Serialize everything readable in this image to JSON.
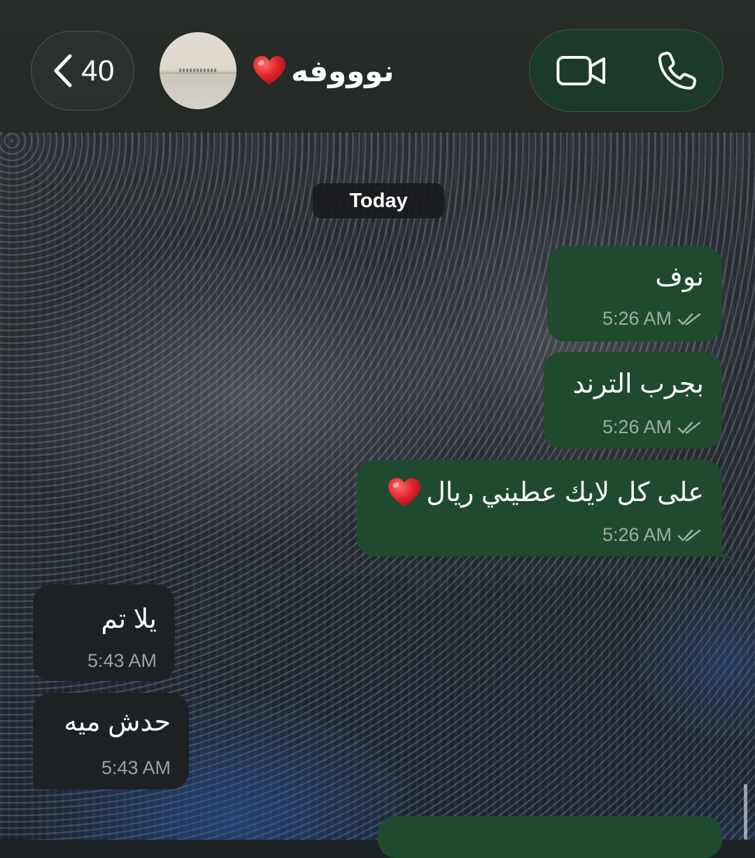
{
  "header": {
    "back_count": "40",
    "contact_name": "نوووفه",
    "contact_emoji_icon": "red-heart-icon",
    "video_icon": "video-camera-icon",
    "call_icon": "phone-icon",
    "back_icon": "chevron-left-icon"
  },
  "chat": {
    "day_label": "Today",
    "messages": [
      {
        "direction": "outgoing",
        "text": "نوف",
        "time": "5:26 AM",
        "status": "read"
      },
      {
        "direction": "outgoing",
        "text": "بجرب الترند",
        "time": "5:26 AM",
        "status": "read"
      },
      {
        "direction": "outgoing",
        "text": "على كل لايك عطيني ريال",
        "emoji_icon": "red-heart-icon",
        "time": "5:26 AM",
        "status": "read"
      },
      {
        "direction": "incoming",
        "text": "يلا تم",
        "time": "5:43 AM"
      },
      {
        "direction": "incoming",
        "text": "حدش ميه",
        "time": "5:43 AM"
      }
    ]
  },
  "colors": {
    "header_bg": "#262b26",
    "outgoing_bubble": "#1f4a2f",
    "incoming_bubble": "#1e2124",
    "call_pill_bg": "#1b3a2a"
  }
}
